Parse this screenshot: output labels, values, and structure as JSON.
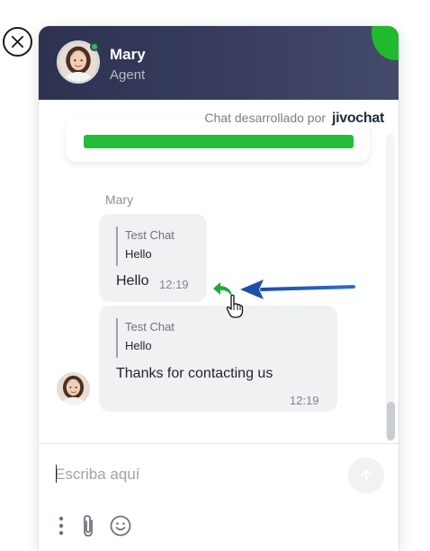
{
  "header": {
    "agent_name": "Mary",
    "agent_role": "Agent",
    "status": "online"
  },
  "powered_by": {
    "text": "Chat desarrollado por",
    "brand": "jivochat"
  },
  "messages": [
    {
      "sender": "Mary",
      "quote_title": "Test Chat",
      "quote_text": "Hello",
      "text": "Hello",
      "time": "12:19"
    },
    {
      "quote_title": "Test Chat",
      "quote_text": "Hello",
      "text": "Thanks for contacting us",
      "time": "12:19"
    }
  ],
  "composer": {
    "placeholder": "Escriba aquí"
  },
  "icons": {
    "close": "close-icon",
    "reply": "reply-icon",
    "cursor": "hand-cursor-icon",
    "send": "arrow-up-icon",
    "more": "more-vertical-icon",
    "attach": "paperclip-icon",
    "emoji": "emoji-icon"
  },
  "colors": {
    "header": "#353a59",
    "accent_green": "#21bd39",
    "bubble": "#f0f1f3",
    "annotation_arrow": "#1f4fa8"
  }
}
